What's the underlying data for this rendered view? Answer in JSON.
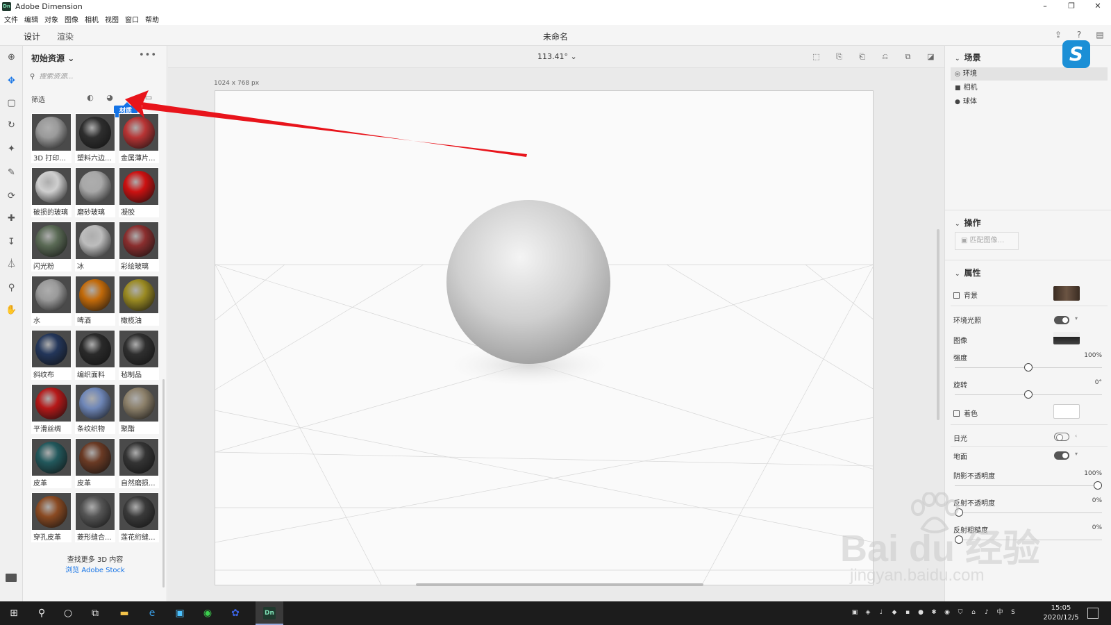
{
  "window": {
    "title": "Adobe Dimension",
    "logo_text": "Dn",
    "controls": [
      "–",
      "❐",
      "✕"
    ]
  },
  "menu": [
    "文件",
    "编辑",
    "对象",
    "图像",
    "相机",
    "视图",
    "窗口",
    "帮助"
  ],
  "modes": {
    "design": "设计",
    "render": "渲染"
  },
  "document_title": "未命名",
  "assets": {
    "title": "初始资源",
    "search_placeholder": "搜索资源...",
    "filter_label": "筛选",
    "tooltip": "材质",
    "find_more": "查找更多 3D 内容",
    "stock_link": "浏览 Adobe Stock",
    "materials": [
      {
        "label": "3D 打印...",
        "color": "#9a9a9a"
      },
      {
        "label": "塑料六边...",
        "color": "#2e2e2e"
      },
      {
        "label": "金属薄片...",
        "color": "#b83434"
      },
      {
        "label": "破损的玻璃",
        "color": "#cfcfcf"
      },
      {
        "label": "磨砂玻璃",
        "color": "#a8a8a8"
      },
      {
        "label": "凝胶",
        "color": "#cc1111"
      },
      {
        "label": "闪光粉",
        "color": "#5a6a55"
      },
      {
        "label": "冰",
        "color": "#bdbdbd"
      },
      {
        "label": "彩绘玻璃",
        "color": "#8a2e2e"
      },
      {
        "label": "水",
        "color": "#9a9a9a"
      },
      {
        "label": "啤酒",
        "color": "#c26a0a"
      },
      {
        "label": "橄榄油",
        "color": "#9a8a22"
      },
      {
        "label": "斜纹布",
        "color": "#23365a"
      },
      {
        "label": "编织面料",
        "color": "#2a2a2a"
      },
      {
        "label": "毡制品",
        "color": "#2f2f2f"
      },
      {
        "label": "平滑丝绸",
        "color": "#b51818"
      },
      {
        "label": "条纹织物",
        "color": "#6f87b8"
      },
      {
        "label": "聚酯",
        "color": "#8c806a"
      },
      {
        "label": "皮革",
        "color": "#22585c"
      },
      {
        "label": "皮革",
        "color": "#6a3a24"
      },
      {
        "label": "自然磨损...",
        "color": "#343434"
      },
      {
        "label": "穿孔皮革",
        "color": "#8a4a22"
      },
      {
        "label": "菱形缝合...",
        "color": "#555555"
      },
      {
        "label": "莲花绗缝...",
        "color": "#3a3a3a"
      }
    ]
  },
  "viewport": {
    "zoom": "113.41°",
    "dimensions": "1024 x 768 px"
  },
  "right_panel": {
    "scene": {
      "title": "场景",
      "items": [
        {
          "label": "环境",
          "icon": "globe-icon"
        },
        {
          "label": "相机",
          "icon": "camera-icon"
        },
        {
          "label": "球体",
          "icon": "sphere-icon"
        }
      ]
    },
    "actions": {
      "title": "操作",
      "match_image": "匹配图像..."
    },
    "properties": {
      "title": "属性",
      "background": "背景",
      "env_light": "环境光照",
      "image": "图像",
      "intensity": "强度",
      "intensity_value": "100%",
      "intensity_level": 0.5,
      "rotation": "旋转",
      "rotation_value": "0°",
      "rotation_level": 0.5,
      "tint": "着色",
      "sunlight": "日光",
      "ground": "地面",
      "shadow_opacity": "阴影不透明度",
      "shadow_opacity_value": "100%",
      "shadow_level": 1.0,
      "reflection_opacity": "反射不透明度",
      "reflection_opacity_value": "0%",
      "reflection_level": 0.0,
      "reflection_roughness": "反射粗糙度",
      "reflection_roughness_value": "0%",
      "roughness_level": 0.0
    }
  },
  "taskbar": {
    "time": "15:05",
    "date": "2020/12/5",
    "active_app": "Dn"
  },
  "watermark": {
    "text": "Bai du 经验",
    "sub": "jingyan.baidu.com"
  },
  "colors": {
    "accent": "#1473e6",
    "arrow": "#e8141b"
  }
}
